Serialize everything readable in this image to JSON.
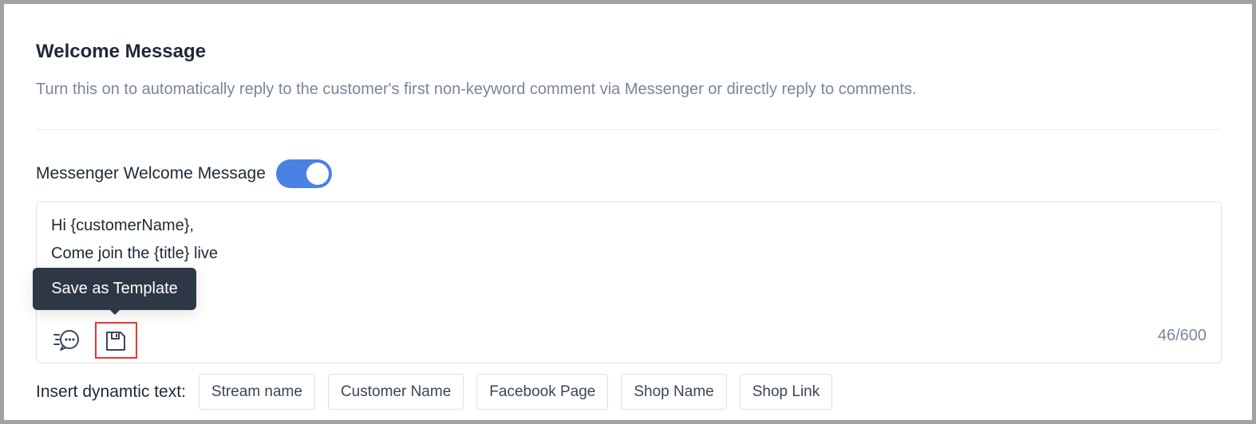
{
  "section": {
    "title": "Welcome Message",
    "description": "Turn this on to automatically reply to the customer's first non-keyword comment via Messenger or directly reply to comments."
  },
  "messenger": {
    "toggle_label": "Messenger Welcome Message",
    "enabled": true,
    "accent_color": "#4a82e2"
  },
  "editor": {
    "lines": [
      "Hi {customerName},",
      "Come join the {title} live"
    ],
    "counter": "46/600",
    "icons": [
      "quick-reply-chat-icon",
      "save-template-icon"
    ]
  },
  "tooltip": {
    "text": "Save as Template"
  },
  "insert": {
    "label": "Insert dynamtic text:",
    "chips": [
      "Stream name",
      "Customer Name",
      "Facebook Page",
      "Shop Name",
      "Shop Link"
    ]
  }
}
